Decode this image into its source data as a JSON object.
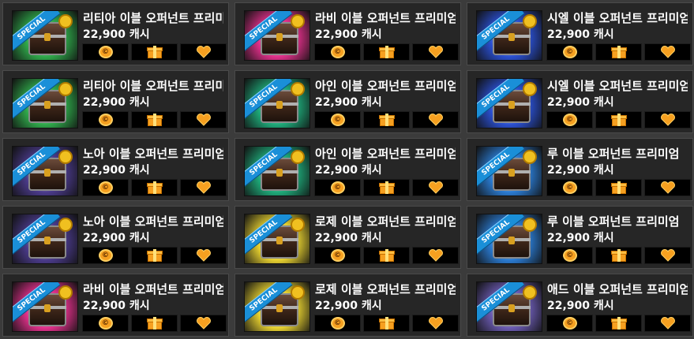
{
  "items": [
    {
      "title": "리티아 이블 오퍼넌트 프리미엄",
      "price": "22,900 캐시",
      "bg": "#2fa84a",
      "coin": "©"
    },
    {
      "title": "라비 이블 오퍼넌트 프리미엄",
      "price": "22,900 캐시",
      "bg": "#e0308a",
      "coin": "©"
    },
    {
      "title": "시엘 이블 오퍼넌트 프리미엄",
      "price": "22,900 캐시",
      "bg": "#2a4fd0",
      "coin": "©"
    },
    {
      "title": "리티아 이블 오퍼넌트 프리미엄",
      "price": "22,900 캐시",
      "bg": "#2fa84a",
      "coin": "©"
    },
    {
      "title": "아인 이블 오퍼넌트 프리미엄",
      "price": "22,900 캐시",
      "bg": "#1ea878",
      "coin": "©"
    },
    {
      "title": "시엘 이블 오퍼넌트 프리미엄",
      "price": "22,900 캐시",
      "bg": "#2a4fd0",
      "coin": "©"
    },
    {
      "title": "노아 이블 오퍼넌트 프리미엄",
      "price": "22,900 캐시",
      "bg": "#4a3a8a",
      "coin": "©"
    },
    {
      "title": "아인 이블 오퍼넌트 프리미엄",
      "price": "22,900 캐시",
      "bg": "#1ea878",
      "coin": "©"
    },
    {
      "title": "루 이블 오퍼넌트 프리미엄",
      "price": "22,900 캐시",
      "bg": "#2a7ad0",
      "coin": "©"
    },
    {
      "title": "노아 이블 오퍼넌트 프리미엄",
      "price": "22,900 캐시",
      "bg": "#4a3a8a",
      "coin": "©"
    },
    {
      "title": "로제 이블 오퍼넌트 프리미엄",
      "price": "22,900 캐시",
      "bg": "#e6d030",
      "coin": "©"
    },
    {
      "title": "루 이블 오퍼넌트 프리미엄",
      "price": "22,900 캐시",
      "bg": "#2a7ad0",
      "coin": "©"
    },
    {
      "title": "라비 이블 오퍼넌트 프리미엄",
      "price": "22,900 캐시",
      "bg": "#e0308a",
      "coin": "©"
    },
    {
      "title": "로제 이블 오퍼넌트 프리미엄",
      "price": "22,900 캐시",
      "bg": "#e6d030",
      "coin": "©"
    },
    {
      "title": "애드 이블 오퍼넌트 프리미엄",
      "price": "22,900 캐시",
      "bg": "#6a5ab0",
      "coin": "©"
    }
  ],
  "ribbon_text": "SPECIAL",
  "icons": {
    "buy": "coin-icon",
    "gift": "gift-icon",
    "wish": "heart-icon"
  },
  "colors": {
    "button_bg": "#000000",
    "icon_accent": "#f6a020",
    "card_bg": "#262626"
  }
}
